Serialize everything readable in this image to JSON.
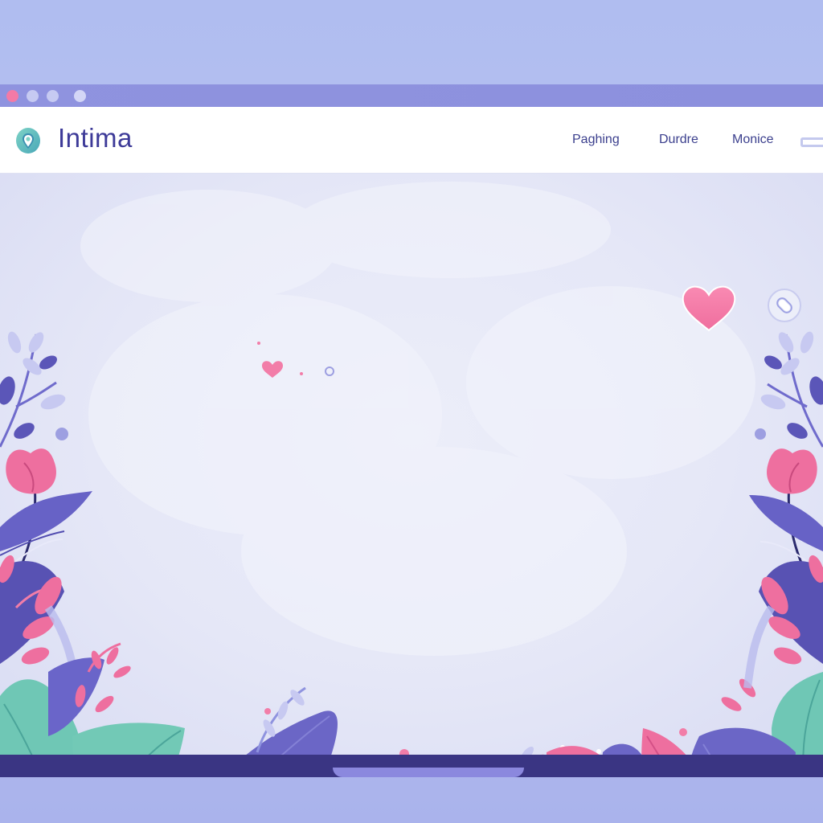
{
  "app": {
    "brand": "Intima"
  },
  "nav": {
    "links": [
      "Paghing",
      "Durdre",
      "Monice"
    ]
  },
  "icons": {
    "logo": "location-pin-icon",
    "like": "heart-icon",
    "action": "circle-toggle-icon",
    "menu": "menu-toggle-icon"
  },
  "colors": {
    "accent_pink": "#f47aa6",
    "brand_purple": "#3d3a98",
    "frame_purple": "#8f93df",
    "leaf_teal": "#6fc7b5",
    "leaf_violet": "#6b66c6",
    "bottom_bar": "#3a3583"
  }
}
